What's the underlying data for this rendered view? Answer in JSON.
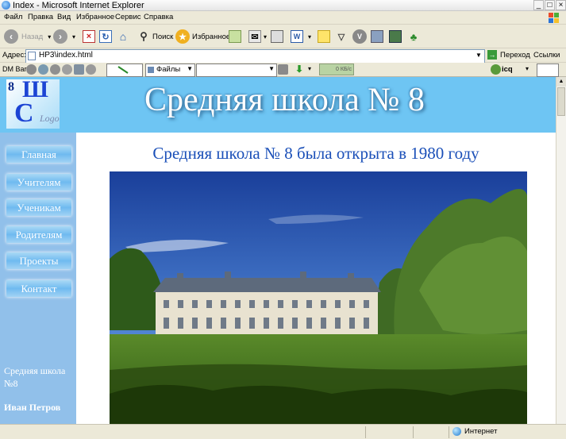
{
  "window": {
    "title": "Index - Microsoft Internet Explorer"
  },
  "menu": {
    "items": [
      "Файл",
      "Правка",
      "Вид",
      "Избранное",
      "Сервис",
      "Справка"
    ]
  },
  "toolbar": {
    "back_label": "Назад",
    "search_label": "Поиск",
    "favorites_label": "Избранное"
  },
  "address": {
    "label": "Адрес:",
    "value": "HP3\\index.html",
    "go_label": "Переход",
    "links_label": "Ссылки"
  },
  "dmbar": {
    "label": "DM Bar",
    "files_label": "Файлы",
    "speed": "0 КБ/с",
    "icq_label": "icq"
  },
  "page": {
    "banner_title": "Средняя школа № 8",
    "logo": {
      "top_left": "8",
      "top": "Ш",
      "big": "С",
      "small": "Logo"
    },
    "heading": "Средняя школа № 8 была открыта в 1980 году",
    "nav": [
      "Главная",
      "Учителям",
      "Ученикам",
      "Родителям",
      "Проекты",
      "Контакт"
    ],
    "side_school": "Средняя школа №8",
    "side_name": "Иван Петров"
  },
  "status": {
    "zone": "Интернет"
  },
  "colors": {
    "banner": "#6ec5f3",
    "sidebar": "#91c0ea",
    "heading": "#1a4fb8"
  }
}
